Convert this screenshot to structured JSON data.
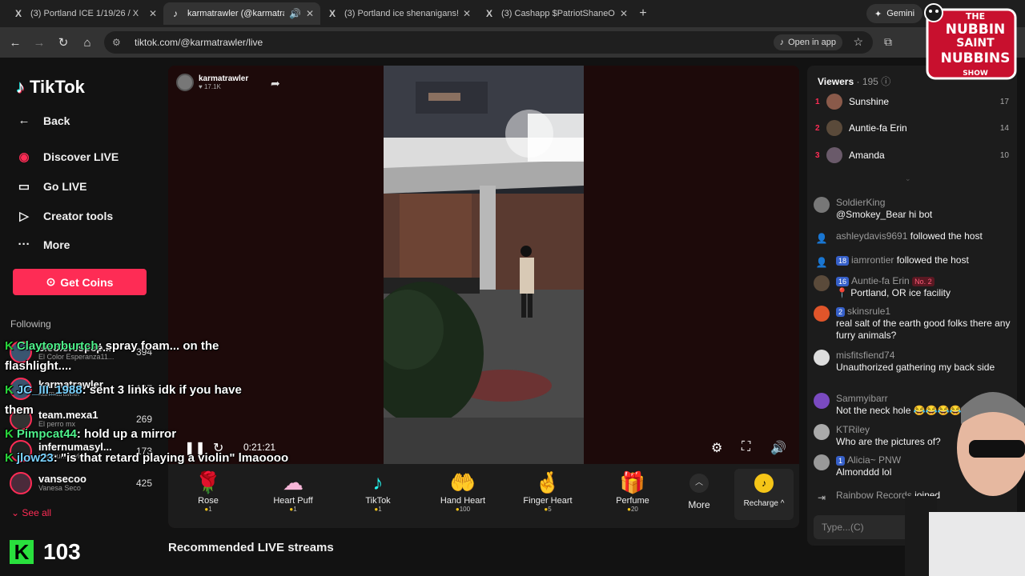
{
  "browser": {
    "tabs": [
      {
        "icon": "X",
        "title": "(3) Portland ICE 1/19/26 / X",
        "active": false
      },
      {
        "icon": "♪",
        "title": "karmatrawler (@karmatrawler)",
        "active": true
      },
      {
        "icon": "X",
        "title": "(3) Portland ice shenanigans! / X",
        "active": false
      },
      {
        "icon": "X",
        "title": "(3) Cashapp $PatriotShaneOreg",
        "active": false
      }
    ],
    "gemini_label": "Gemini",
    "url": "tiktok.com/@karmatrawler/live",
    "open_in_app": "Open in app"
  },
  "sidebar": {
    "logo": "TikTok",
    "nav": [
      {
        "icon": "←",
        "label": "Back"
      },
      {
        "icon": "◉",
        "label": "Discover LIVE"
      },
      {
        "icon": "▭",
        "label": "Go LIVE"
      },
      {
        "icon": "▷",
        "label": "Creator tools"
      },
      {
        "icon": "···",
        "label": "More"
      }
    ],
    "get_coins": "Get Coins",
    "following_heading": "Following",
    "following": [
      {
        "name": "elcolorespер...",
        "sub": "El Color Esperanza11...",
        "count": "394"
      },
      {
        "name": "karmatrawler",
        "sub": "karmatrawler",
        "count": "107"
      },
      {
        "name": "team.mexa1",
        "sub": "El perro mx",
        "count": "269"
      },
      {
        "name": "infernumasyl...",
        "sub": "infernumasylum",
        "count": "173"
      },
      {
        "name": "vansecoo",
        "sub": "Vanesa Seco",
        "count": "425"
      }
    ],
    "see_all": "See all"
  },
  "overlay_chat": [
    {
      "user": "Claytonburtch",
      "text": ": spray foam... on the"
    },
    {
      "user": "",
      "text": "flashlight...."
    },
    {
      "user": "JC_III_1988",
      "text": ": sent 3 links idk if you have"
    },
    {
      "user": "",
      "text": "them"
    },
    {
      "user": "Pimpcat44",
      "text": ": hold up a mirror"
    },
    {
      "user": "jlow23",
      "text": ": \"is that retard playing a violin\" lmaoooo"
    }
  ],
  "kick": {
    "logo": "K",
    "count": "103"
  },
  "video": {
    "host_name": "karmatrawler",
    "host_likes": "♥ 17.1K",
    "time": "0:21:21"
  },
  "gifts": [
    {
      "icon": "🌹",
      "name": "Rose",
      "cost": "1"
    },
    {
      "icon": "☁",
      "name": "Heart Puff",
      "cost": "1"
    },
    {
      "icon": "♪",
      "name": "TikTok",
      "cost": "1"
    },
    {
      "icon": "🤲",
      "name": "Hand Heart",
      "cost": "100"
    },
    {
      "icon": "🤞",
      "name": "Finger Heart",
      "cost": "5"
    },
    {
      "icon": "🎁",
      "name": "Perfume",
      "cost": "20"
    }
  ],
  "more_label": "More",
  "recharge_label": "Recharge ^",
  "recommended_title": "Recommended LIVE streams",
  "viewers": {
    "title": "Viewers",
    "count": "· 195",
    "top": [
      {
        "rank": "1",
        "name": "Sunshine",
        "score": "17"
      },
      {
        "rank": "2",
        "name": "Auntie-fa Erin",
        "score": "14"
      },
      {
        "rank": "3",
        "name": "Amanda",
        "score": "10"
      }
    ]
  },
  "chat": [
    {
      "name": "SoldierKing",
      "text": "@Smokey_Bear hi bot",
      "badge": "",
      "rank_badge": ""
    },
    {
      "name": "ashleydavis9691",
      "text": "followed the host",
      "badge": "",
      "rank_badge": ""
    },
    {
      "name": "iamrontier",
      "text": "followed the host",
      "badge": "18",
      "rank_badge": ""
    },
    {
      "name": "Auntie-fa Erin",
      "text": "📍 Portland, OR ice facility",
      "badge": "16",
      "rank_badge": "No. 2"
    },
    {
      "name": "skinsrule1",
      "text": "real salt of the earth good folks there any furry animals?",
      "badge": "2",
      "rank_badge": ""
    },
    {
      "name": "misfitsfiend74",
      "text": "Unauthorized gathering my back side",
      "badge": "",
      "rank_badge": ""
    },
    {
      "name": "Sammyibarr",
      "text": "Not the neck hole 😂😂😂😂",
      "badge": "",
      "rank_badge": ""
    },
    {
      "name": "KTRiley",
      "text": "Who are the pictures of?",
      "badge": "",
      "rank_badge": ""
    },
    {
      "name": "Alicia~ PNW",
      "text": "Almonddd lol",
      "badge": "1",
      "rank_badge": ""
    },
    {
      "name": "Rainbow Records",
      "text": "joined",
      "badge": "",
      "rank_badge": ""
    }
  ],
  "chat_placeholder": "Type...(C)",
  "show_logo": {
    "line1": "THE",
    "line2": "NUBBIN",
    "line3": "SAINT",
    "line4": "NUBBINS",
    "line5": "SHOW"
  },
  "colors": {
    "accent": "#fe2c55",
    "kick_green": "#29e03d",
    "coin": "#f5c518"
  }
}
